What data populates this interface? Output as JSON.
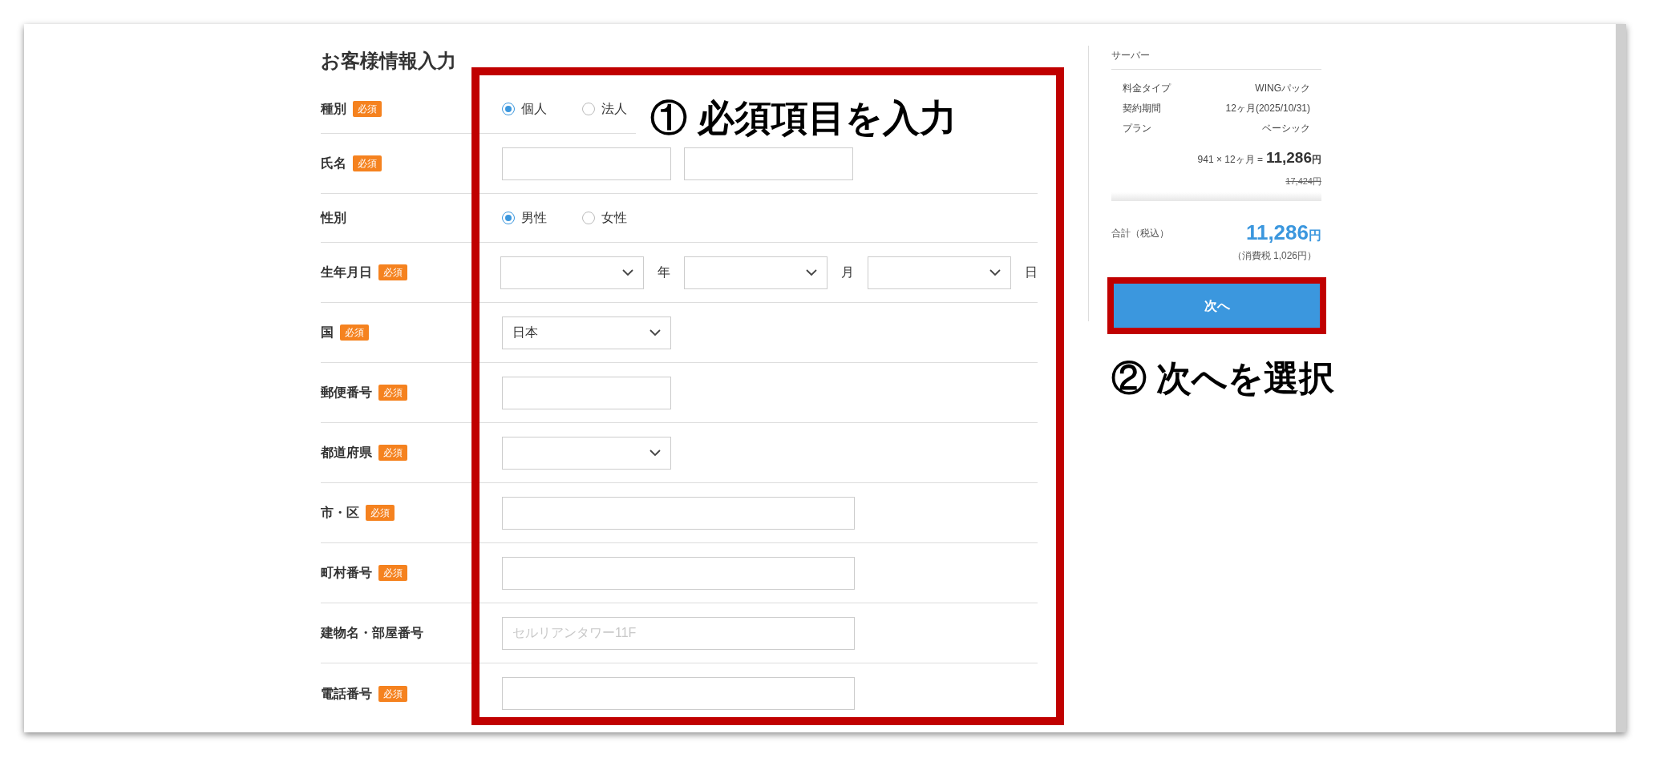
{
  "title": "お客様情報入力",
  "rows": [
    {
      "label": "種別",
      "badge": "必須",
      "kind": "radio",
      "options": [
        {
          "label": "個人",
          "selected": true
        },
        {
          "label": "法人",
          "selected": false
        }
      ]
    },
    {
      "label": "氏名",
      "badge": "必須",
      "kind": "text_pair"
    },
    {
      "label": "性別",
      "kind": "radio",
      "options": [
        {
          "label": "男性",
          "selected": true
        },
        {
          "label": "女性",
          "selected": false
        }
      ]
    },
    {
      "label": "生年月日",
      "badge": "必須",
      "kind": "date",
      "units": [
        "年",
        "月",
        "日"
      ]
    },
    {
      "label": "国",
      "badge": "必須",
      "kind": "select",
      "value": "日本"
    },
    {
      "label": "郵便番号",
      "badge": "必須",
      "kind": "text_short"
    },
    {
      "label": "都道府県",
      "badge": "必須",
      "kind": "select"
    },
    {
      "label": "市・区",
      "badge": "必須",
      "kind": "text_long"
    },
    {
      "label": "町村番号",
      "badge": "必須",
      "kind": "text_long"
    },
    {
      "label": "建物名・部屋番号",
      "kind": "text_long",
      "placeholder": "セルリアンタワー11F"
    },
    {
      "label": "電話番号",
      "badge": "必須",
      "kind": "text_long"
    }
  ],
  "summary": {
    "heading": "サーバー",
    "items": [
      {
        "label": "料金タイプ",
        "value": "WINGパック"
      },
      {
        "label": "契約期間",
        "value": "12ヶ月(2025/10/31)"
      },
      {
        "label": "プラン",
        "value": "ベーシック"
      }
    ],
    "calc": "941 × 12ヶ月 =",
    "amount": "11,286",
    "currency": "円",
    "original_price": "17,424円",
    "total_label": "合計（税込）",
    "total_amount": "11,286",
    "total_currency": "円",
    "tax_note": "（消費税 1,026円）"
  },
  "next_button": "次へ",
  "annotations": [
    "① 必須項目を入力",
    "② 次へを選択"
  ]
}
